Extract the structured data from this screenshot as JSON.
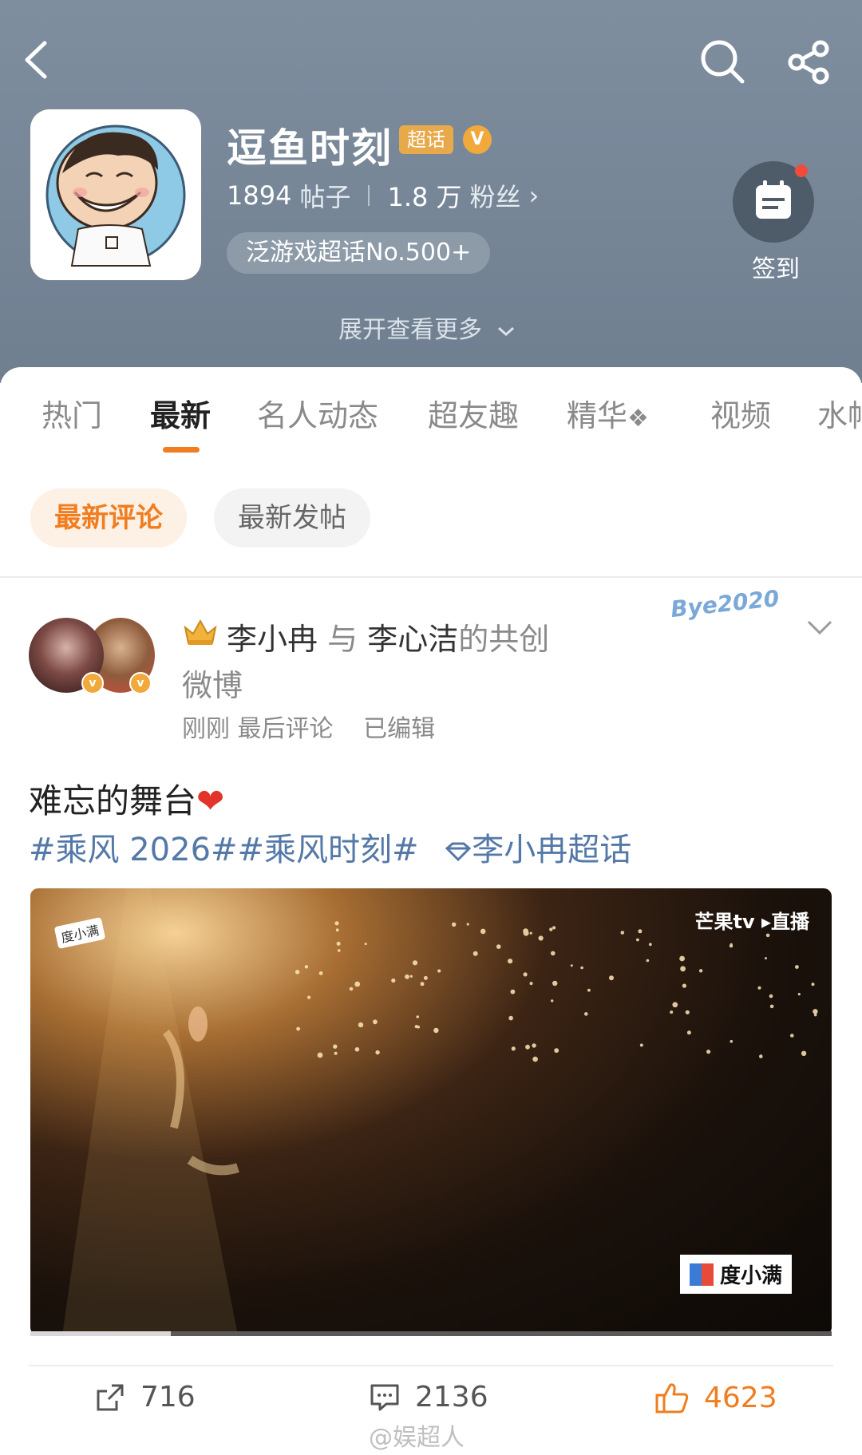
{
  "header": {
    "title": "逗鱼时刻",
    "super_badge": "超话",
    "verified_badge": "V",
    "posts_count": "1894",
    "posts_label": "帖子",
    "fans_count": "1.8 万",
    "fans_label": "粉丝",
    "fans_chevron": "›",
    "rank_label": "泛游戏超话No.500+",
    "checkin_label": "签到",
    "expand_label": "展开查看更多"
  },
  "tabs": [
    {
      "label": "热门"
    },
    {
      "label": "最新"
    },
    {
      "label": "名人动态"
    },
    {
      "label": "超友趣"
    },
    {
      "label": "精华"
    },
    {
      "label": "视频"
    },
    {
      "label": "水帖"
    }
  ],
  "filters": {
    "active": "最新评论",
    "inactive": "最新发帖"
  },
  "post": {
    "author1": "李小冉",
    "connector": "与",
    "author2": "李心洁",
    "suffix": "的共创",
    "suffix2": "微博",
    "time": "刚刚",
    "last_comment": "最后评论",
    "edited": "已编辑",
    "decoration": "Bye2020",
    "text": "难忘的舞台",
    "emoji": "❤",
    "hashtags": "#乘风 2026##乘风时刻#",
    "topic": "李小冉超话",
    "video": {
      "watermark_top": "芒果tv ▸直播",
      "watermark_left": "度小满",
      "watermark_br": "度小满",
      "progress": 0.175
    },
    "actions": {
      "repost": "716",
      "comment": "2136",
      "like": "4623"
    }
  },
  "corner_watermark": "@娱超人",
  "colors": {
    "header_bg": "#7a8a9b",
    "accent": "#f07d1f",
    "link": "#5479a8"
  }
}
